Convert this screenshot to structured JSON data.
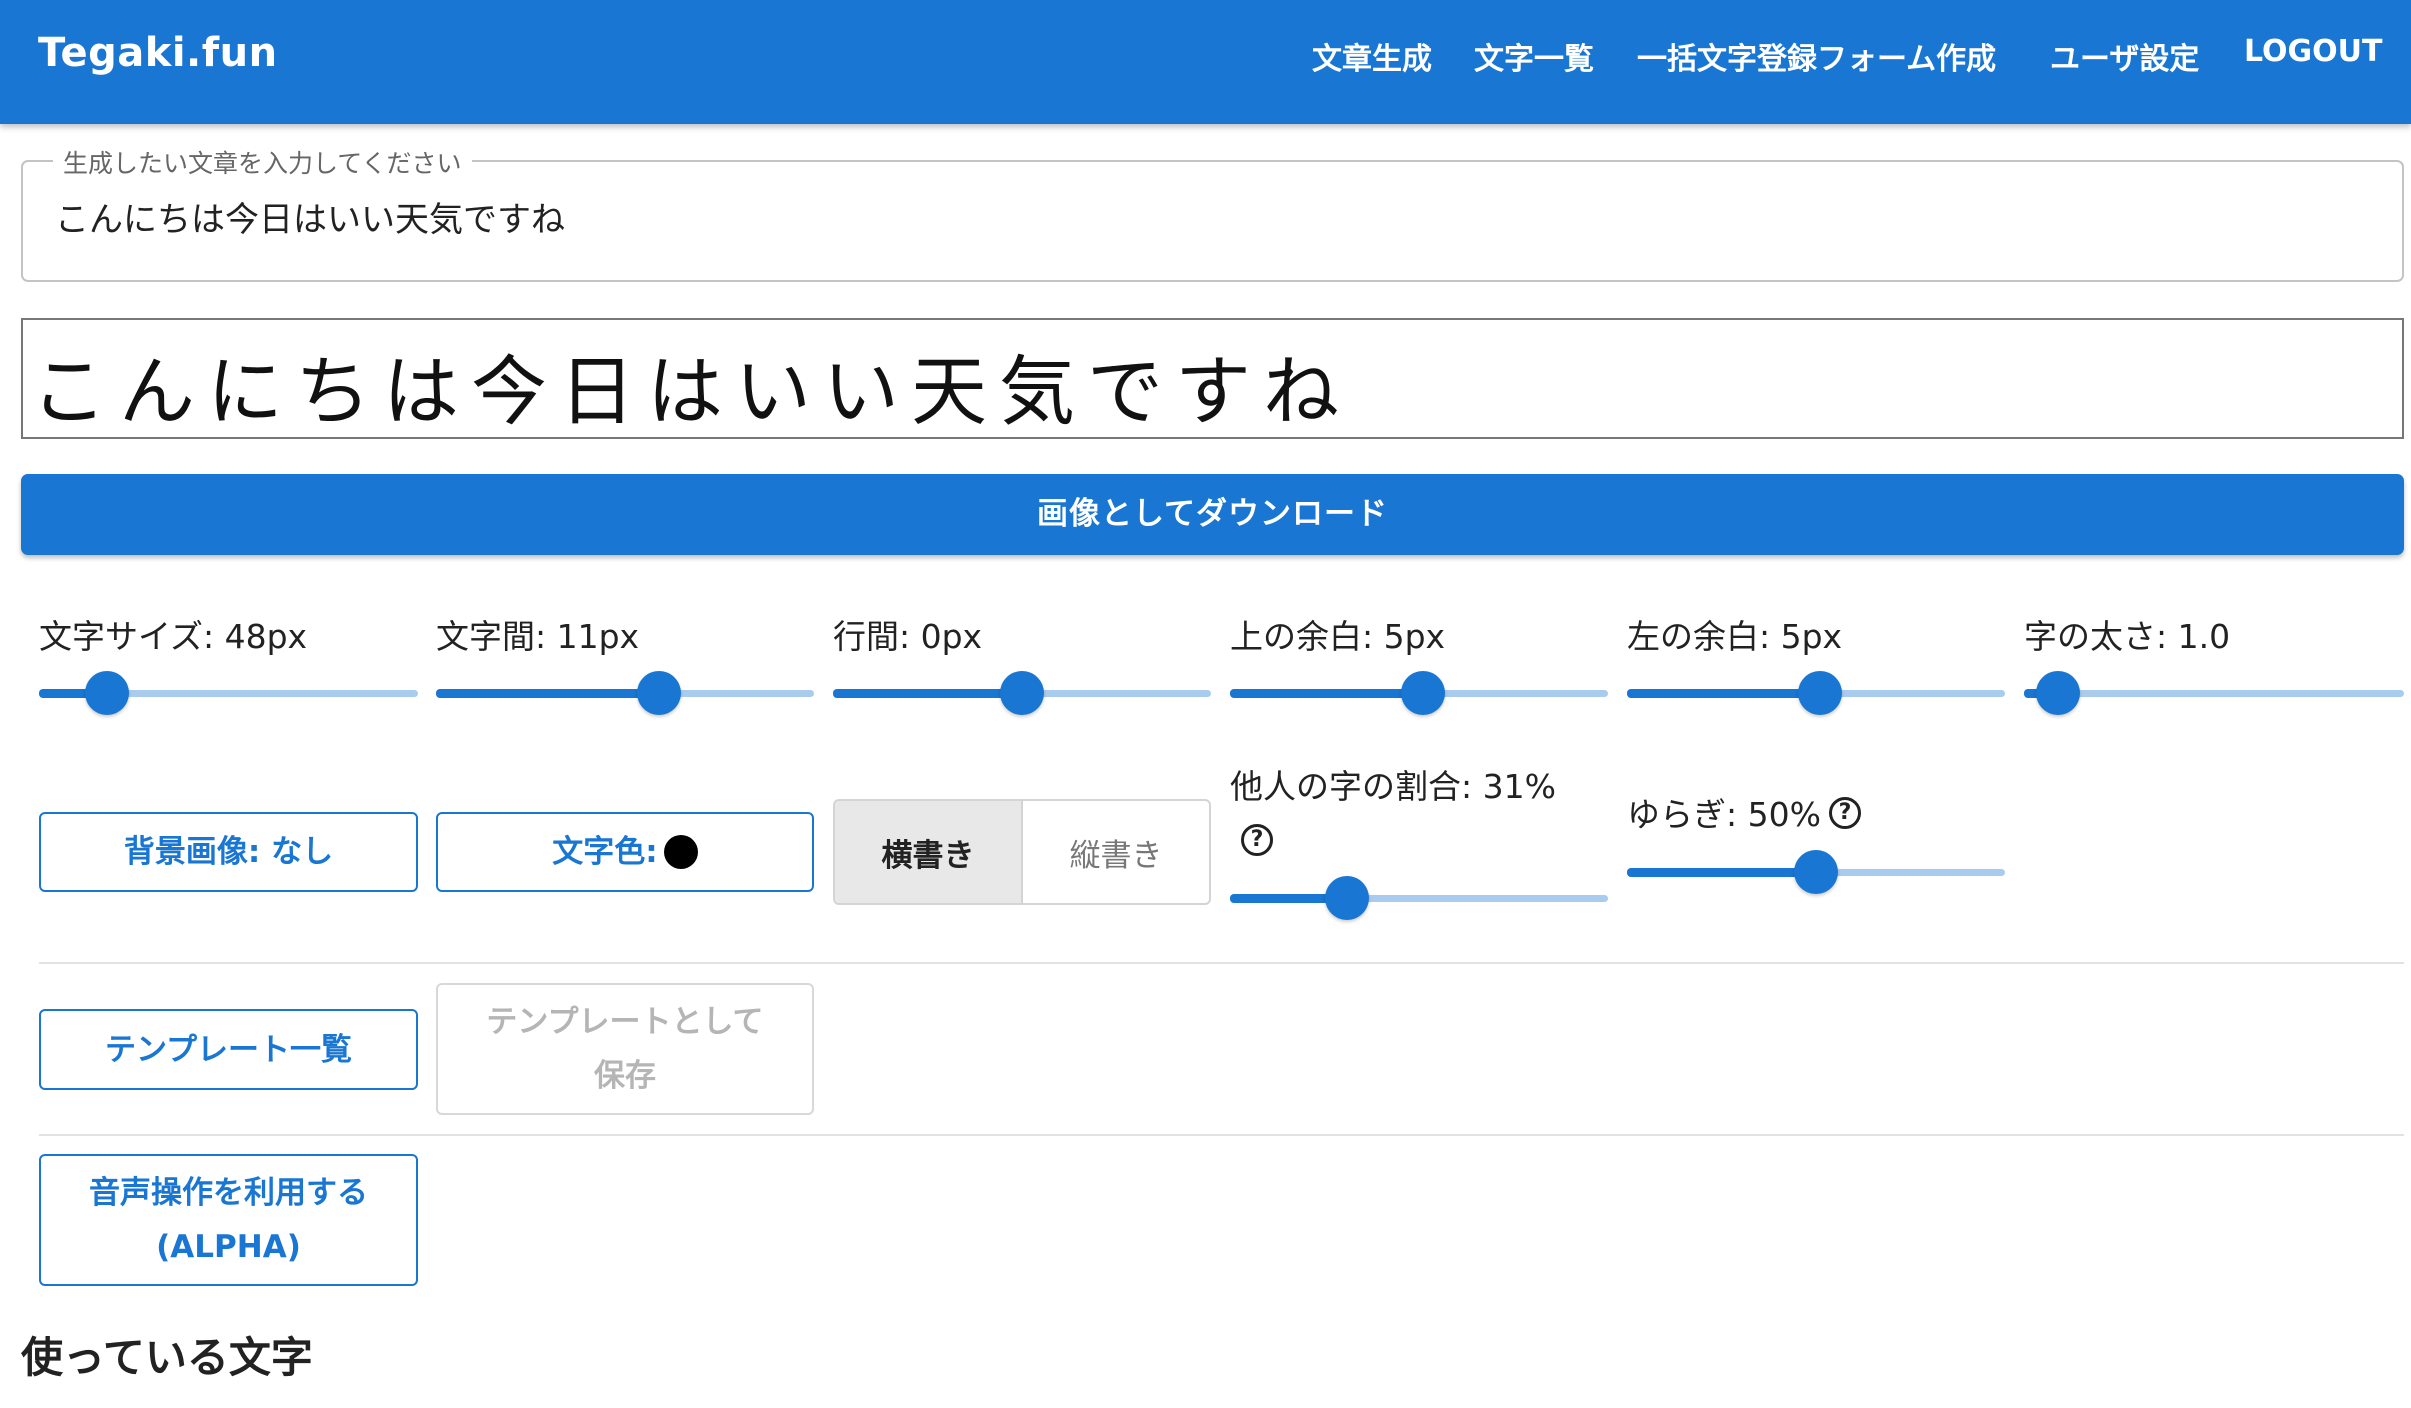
{
  "header": {
    "brand": "Tegaki.fun",
    "nav": [
      "文章生成",
      "文字一覧",
      "一括文字登録フォーム作成",
      "ユーザ設定",
      "LOGOUT"
    ]
  },
  "input": {
    "label": "生成したい文章を入力してください",
    "value": "こんにちは今日はいい天気ですね"
  },
  "preview": {
    "text": "こんにちは今日はいい天気ですね"
  },
  "download_label": "画像としてダウンロード",
  "sliders": [
    {
      "label": "文字サイズ: 48px",
      "fraction": 0.18
    },
    {
      "label": "文字間: 11px",
      "fraction": 0.59
    },
    {
      "label": "行間: 0px",
      "fraction": 0.5
    },
    {
      "label": "上の余白: 5px",
      "fraction": 0.51
    },
    {
      "label": "左の余白: 5px",
      "fraction": 0.51
    },
    {
      "label": "字の太さ: 1.0",
      "fraction": 0.09
    },
    {
      "label": "他人の字の割合: 31%",
      "fraction": 0.31
    },
    {
      "label": "ゆらぎ: 50%",
      "fraction": 0.5
    }
  ],
  "buttons": {
    "background": "背景画像: なし",
    "text_color": "文字色:",
    "template_list": "テンプレート一覧",
    "save_template": "テンプレートとして保存",
    "voice": "音声操作を利用する (ALPHA)"
  },
  "orientation": {
    "horizontal": "横書き",
    "vertical": "縦書き",
    "selected": "横書き"
  },
  "help_glyph": "?",
  "section_title": "使っている文字",
  "colors": {
    "primary": "#1976d2",
    "track": "#a9cbee",
    "text_color_value": "#000000"
  },
  "icons": [
    "help-icon",
    "color-swatch-icon"
  ]
}
